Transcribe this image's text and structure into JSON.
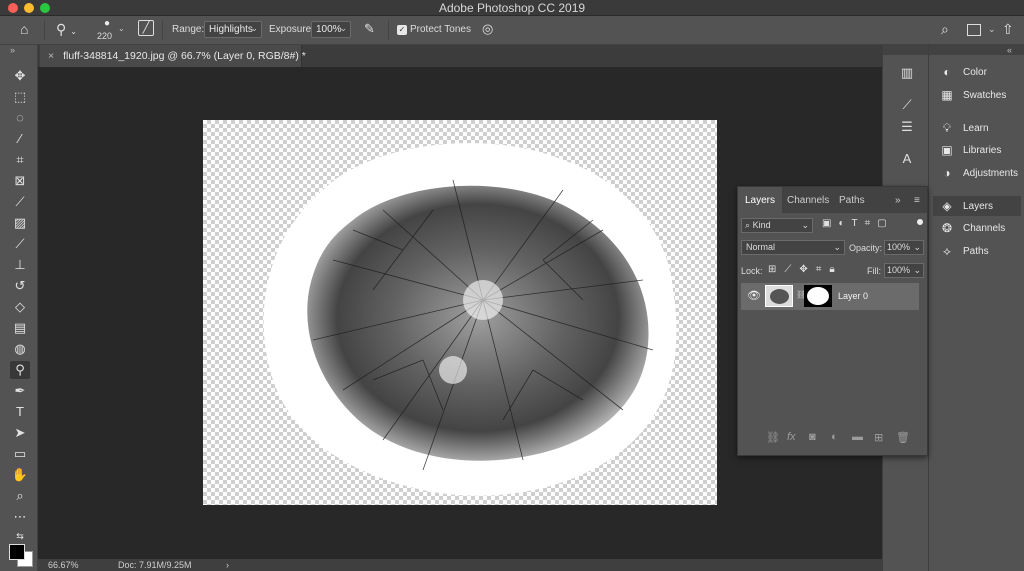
{
  "window": {
    "title": "Adobe Photoshop CC 2019"
  },
  "options_bar": {
    "brush_size": "220",
    "range_label": "Range:",
    "range_value": "Highlights",
    "exposure_label": "Exposure:",
    "exposure_value": "100%",
    "protect_tones_label": "Protect Tones",
    "protect_tones_checked": true
  },
  "document": {
    "tab_title": "fluff-348814_1920.jpg @ 66.7% (Layer 0, RGB/8#) *",
    "zoom": "66.67%",
    "doc_size": "Doc: 7.91M/9.25M"
  },
  "right_panels": {
    "items": [
      {
        "label": "Color",
        "icon": "color-wheel-icon"
      },
      {
        "label": "Swatches",
        "icon": "grid-icon"
      },
      {
        "label": "Learn",
        "icon": "lightbulb-icon"
      },
      {
        "label": "Libraries",
        "icon": "libraries-icon"
      },
      {
        "label": "Adjustments",
        "icon": "adjustments-icon"
      },
      {
        "label": "Layers",
        "icon": "layers-icon"
      },
      {
        "label": "Channels",
        "icon": "channels-icon"
      },
      {
        "label": "Paths",
        "icon": "paths-icon"
      }
    ]
  },
  "layers_panel": {
    "tabs": [
      "Layers",
      "Channels",
      "Paths"
    ],
    "filter_kind": "Kind",
    "blend_mode": "Normal",
    "opacity_label": "Opacity:",
    "opacity_value": "100%",
    "lock_label": "Lock:",
    "fill_label": "Fill:",
    "fill_value": "100%",
    "layers": [
      {
        "name": "Layer 0",
        "visible": true
      }
    ]
  }
}
